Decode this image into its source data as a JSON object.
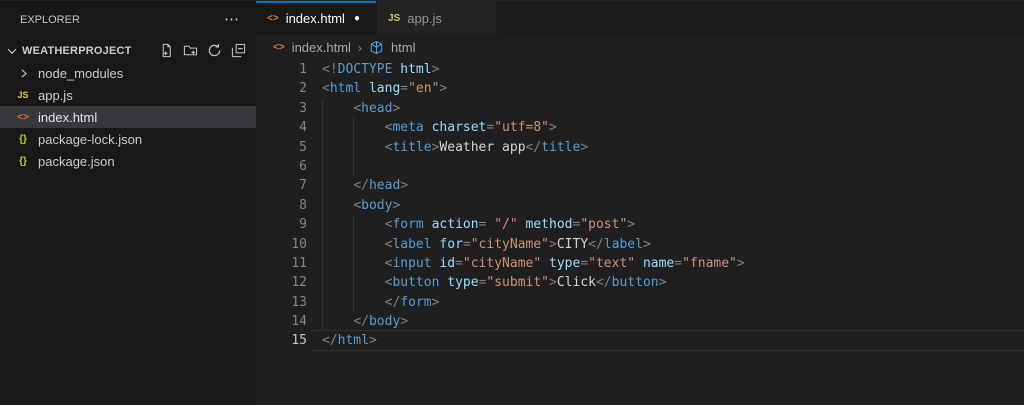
{
  "sidebar": {
    "header": "EXPLORER",
    "more_icon": "⋯",
    "project": "WEATHERPROJECT",
    "toolbar": [
      {
        "name": "new-file",
        "title": "New File..."
      },
      {
        "name": "new-folder",
        "title": "New Folder..."
      },
      {
        "name": "refresh",
        "title": "Refresh Explorer"
      },
      {
        "name": "collapse-all",
        "title": "Collapse Folders in Explorer"
      }
    ],
    "items": [
      {
        "label": "node_modules",
        "icon": "chevron-right",
        "selected": false
      },
      {
        "label": "app.js",
        "icon": "js",
        "selected": false
      },
      {
        "label": "index.html",
        "icon": "html",
        "selected": true
      },
      {
        "label": "package-lock.json",
        "icon": "json",
        "selected": false
      },
      {
        "label": "package.json",
        "icon": "json",
        "selected": false
      }
    ]
  },
  "tabs": [
    {
      "label": "index.html",
      "icon": "html",
      "active": true,
      "modified": true,
      "modified_icon": "●"
    },
    {
      "label": "app.js",
      "icon": "js",
      "active": false,
      "modified": false
    }
  ],
  "breadcrumb": {
    "file": "index.html",
    "file_icon": "html",
    "separator": "›",
    "symbol": "html",
    "symbol_icon": "symbol-cube"
  },
  "editor": {
    "active_line": 15,
    "lines": [
      {
        "n": 1,
        "g": 0,
        "tokens": [
          [
            "p",
            "<!"
          ],
          [
            "t",
            "DOCTYPE"
          ],
          [
            "a",
            " html"
          ],
          [
            "p",
            ">"
          ]
        ]
      },
      {
        "n": 2,
        "g": 0,
        "tokens": [
          [
            "p",
            "<"
          ],
          [
            "t",
            "html"
          ],
          [
            "a",
            " lang"
          ],
          [
            "p",
            "="
          ],
          [
            "s",
            "\"en\""
          ],
          [
            "p",
            ">"
          ]
        ]
      },
      {
        "n": 3,
        "g": 1,
        "tokens": [
          [
            "x",
            "    "
          ],
          [
            "p",
            "<"
          ],
          [
            "t",
            "head"
          ],
          [
            "p",
            ">"
          ]
        ]
      },
      {
        "n": 4,
        "g": 2,
        "tokens": [
          [
            "x",
            "        "
          ],
          [
            "p",
            "<"
          ],
          [
            "t",
            "meta"
          ],
          [
            "a",
            " charset"
          ],
          [
            "p",
            "="
          ],
          [
            "s",
            "\"utf=8\""
          ],
          [
            "p",
            ">"
          ]
        ]
      },
      {
        "n": 5,
        "g": 2,
        "tokens": [
          [
            "x",
            "        "
          ],
          [
            "p",
            "<"
          ],
          [
            "t",
            "title"
          ],
          [
            "p",
            ">"
          ],
          [
            "x",
            "Weather app"
          ],
          [
            "p",
            "</"
          ],
          [
            "t",
            "title"
          ],
          [
            "p",
            ">"
          ]
        ]
      },
      {
        "n": 6,
        "g": 2,
        "tokens": []
      },
      {
        "n": 7,
        "g": 1,
        "tokens": [
          [
            "x",
            "    "
          ],
          [
            "p",
            "</"
          ],
          [
            "t",
            "head"
          ],
          [
            "p",
            ">"
          ]
        ]
      },
      {
        "n": 8,
        "g": 1,
        "tokens": [
          [
            "x",
            "    "
          ],
          [
            "p",
            "<"
          ],
          [
            "t",
            "body"
          ],
          [
            "p",
            ">"
          ]
        ]
      },
      {
        "n": 9,
        "g": 2,
        "tokens": [
          [
            "x",
            "        "
          ],
          [
            "p",
            "<"
          ],
          [
            "t",
            "form"
          ],
          [
            "a",
            " action"
          ],
          [
            "p",
            "="
          ],
          [
            "x",
            " "
          ],
          [
            "s",
            "\"/\""
          ],
          [
            "a",
            " method"
          ],
          [
            "p",
            "="
          ],
          [
            "s",
            "\"post\""
          ],
          [
            "p",
            ">"
          ]
        ]
      },
      {
        "n": 10,
        "g": 2,
        "tokens": [
          [
            "x",
            "        "
          ],
          [
            "p",
            "<"
          ],
          [
            "t",
            "label"
          ],
          [
            "a",
            " for"
          ],
          [
            "p",
            "="
          ],
          [
            "s",
            "\"cityName\""
          ],
          [
            "p",
            ">"
          ],
          [
            "x",
            "CITY"
          ],
          [
            "p",
            "</"
          ],
          [
            "t",
            "label"
          ],
          [
            "p",
            ">"
          ]
        ]
      },
      {
        "n": 11,
        "g": 2,
        "tokens": [
          [
            "x",
            "        "
          ],
          [
            "p",
            "<"
          ],
          [
            "t",
            "input"
          ],
          [
            "a",
            " id"
          ],
          [
            "p",
            "="
          ],
          [
            "s",
            "\"cityName\""
          ],
          [
            "a",
            " type"
          ],
          [
            "p",
            "="
          ],
          [
            "s",
            "\"text\""
          ],
          [
            "a",
            " name"
          ],
          [
            "p",
            "="
          ],
          [
            "s",
            "\"fname\""
          ],
          [
            "p",
            ">"
          ]
        ]
      },
      {
        "n": 12,
        "g": 2,
        "tokens": [
          [
            "x",
            "        "
          ],
          [
            "p",
            "<"
          ],
          [
            "t",
            "button"
          ],
          [
            "a",
            " type"
          ],
          [
            "p",
            "="
          ],
          [
            "s",
            "\"submit\""
          ],
          [
            "p",
            ">"
          ],
          [
            "x",
            "Click"
          ],
          [
            "p",
            "</"
          ],
          [
            "t",
            "button"
          ],
          [
            "p",
            ">"
          ]
        ]
      },
      {
        "n": 13,
        "g": 2,
        "tokens": [
          [
            "x",
            "        "
          ],
          [
            "p",
            "</"
          ],
          [
            "t",
            "form"
          ],
          [
            "p",
            ">"
          ]
        ]
      },
      {
        "n": 14,
        "g": 1,
        "tokens": [
          [
            "x",
            "    "
          ],
          [
            "p",
            "</"
          ],
          [
            "t",
            "body"
          ],
          [
            "p",
            ">"
          ]
        ]
      },
      {
        "n": 15,
        "g": 0,
        "tokens": [
          [
            "p",
            "</"
          ],
          [
            "t",
            "html"
          ],
          [
            "p",
            ">"
          ]
        ]
      }
    ]
  },
  "colors": {
    "accent_tab_border": "#0078d4",
    "sidebar_bg": "#181818",
    "editor_bg": "#1f1f1f",
    "selection_bg": "#37373d",
    "html_icon": "#e0703a",
    "js_icon": "#d8c64e",
    "json_icon": "#cbcb41",
    "symbol_icon": "#4e9fdd",
    "syntax": {
      "p": "#808080",
      "t": "#569cd6",
      "a": "#9cdcfe",
      "s": "#ce9178",
      "x": "#d4d4d4"
    }
  }
}
